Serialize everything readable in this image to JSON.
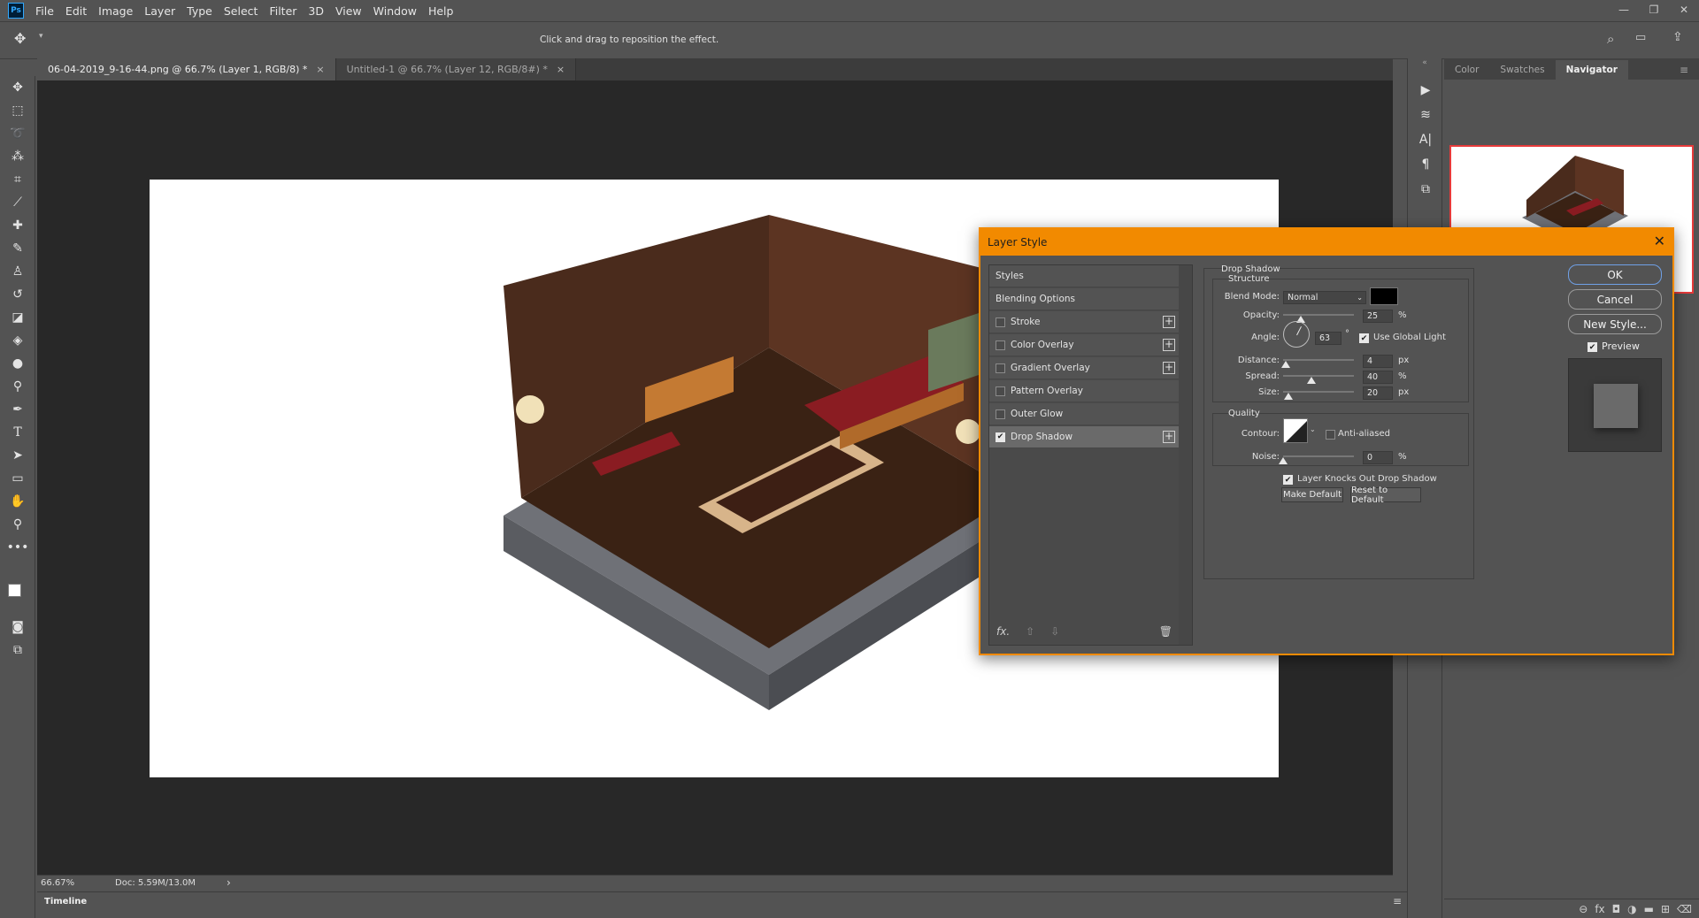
{
  "menu": {
    "logo": "Ps",
    "items": [
      "File",
      "Edit",
      "Image",
      "Layer",
      "Type",
      "Select",
      "Filter",
      "3D",
      "View",
      "Window",
      "Help"
    ]
  },
  "window_controls": {
    "minimize": "—",
    "restore": "❐",
    "close": "✕"
  },
  "options_bar": {
    "hint": "Click and drag to reposition the effect."
  },
  "doc_tabs": [
    {
      "label": "06-04-2019_9-16-44.png @ 66.7% (Layer 1, RGB/8) *",
      "close": "×"
    },
    {
      "label": "Untitled-1 @ 66.7% (Layer 12, RGB/8#) *",
      "close": "×"
    }
  ],
  "status": {
    "zoom": "66.67%",
    "doc": "Doc: 5.59M/13.0M",
    "arrow": "›"
  },
  "timeline": {
    "label": "Timeline"
  },
  "right_panel": {
    "tabs": [
      "Color",
      "Swatches",
      "Navigator"
    ],
    "menu_icon": "≡"
  },
  "dialog": {
    "title": "Layer Style",
    "close": "✕",
    "styles_header": "Styles",
    "blending_options": "Blending Options",
    "effects": [
      {
        "label": "Stroke",
        "checked": false,
        "plus": true
      },
      {
        "label": "Color Overlay",
        "checked": false,
        "plus": true
      },
      {
        "label": "Gradient Overlay",
        "checked": false,
        "plus": true
      },
      {
        "label": "Pattern Overlay",
        "checked": false,
        "plus": false
      },
      {
        "label": "Outer Glow",
        "checked": false,
        "plus": false
      },
      {
        "label": "Drop Shadow",
        "checked": true,
        "plus": true
      }
    ],
    "footer": {
      "fx": "fx.",
      "up": "⇧",
      "down": "⇩",
      "trash": "🗑"
    },
    "drop_shadow": {
      "title": "Drop Shadow",
      "structure": "Structure",
      "blend_mode_label": "Blend Mode:",
      "blend_mode": "Normal",
      "color": "#000000",
      "opacity_label": "Opacity:",
      "opacity": "25",
      "opacity_unit": "%",
      "opacity_level": 0.25,
      "angle_label": "Angle:",
      "angle": "63",
      "angle_unit": "°",
      "global_light_label": "Use Global Light",
      "global_light": true,
      "distance_label": "Distance:",
      "distance": "4",
      "distance_unit": "px",
      "distance_level": 0.04,
      "spread_label": "Spread:",
      "spread": "40",
      "spread_unit": "%",
      "spread_level": 0.4,
      "size_label": "Size:",
      "size": "20",
      "size_unit": "px",
      "size_level": 0.08,
      "quality": "Quality",
      "contour_label": "Contour:",
      "anti_aliased_label": "Anti-aliased",
      "anti_aliased": false,
      "noise_label": "Noise:",
      "noise": "0",
      "noise_unit": "%",
      "noise_level": 0,
      "knockout_label": "Layer Knocks Out Drop Shadow",
      "knockout": true,
      "make_default": "Make Default",
      "reset_default": "Reset to Default"
    },
    "buttons": {
      "ok": "OK",
      "cancel": "Cancel",
      "new_style": "New Style...",
      "preview": "Preview",
      "preview_checked": true
    }
  }
}
